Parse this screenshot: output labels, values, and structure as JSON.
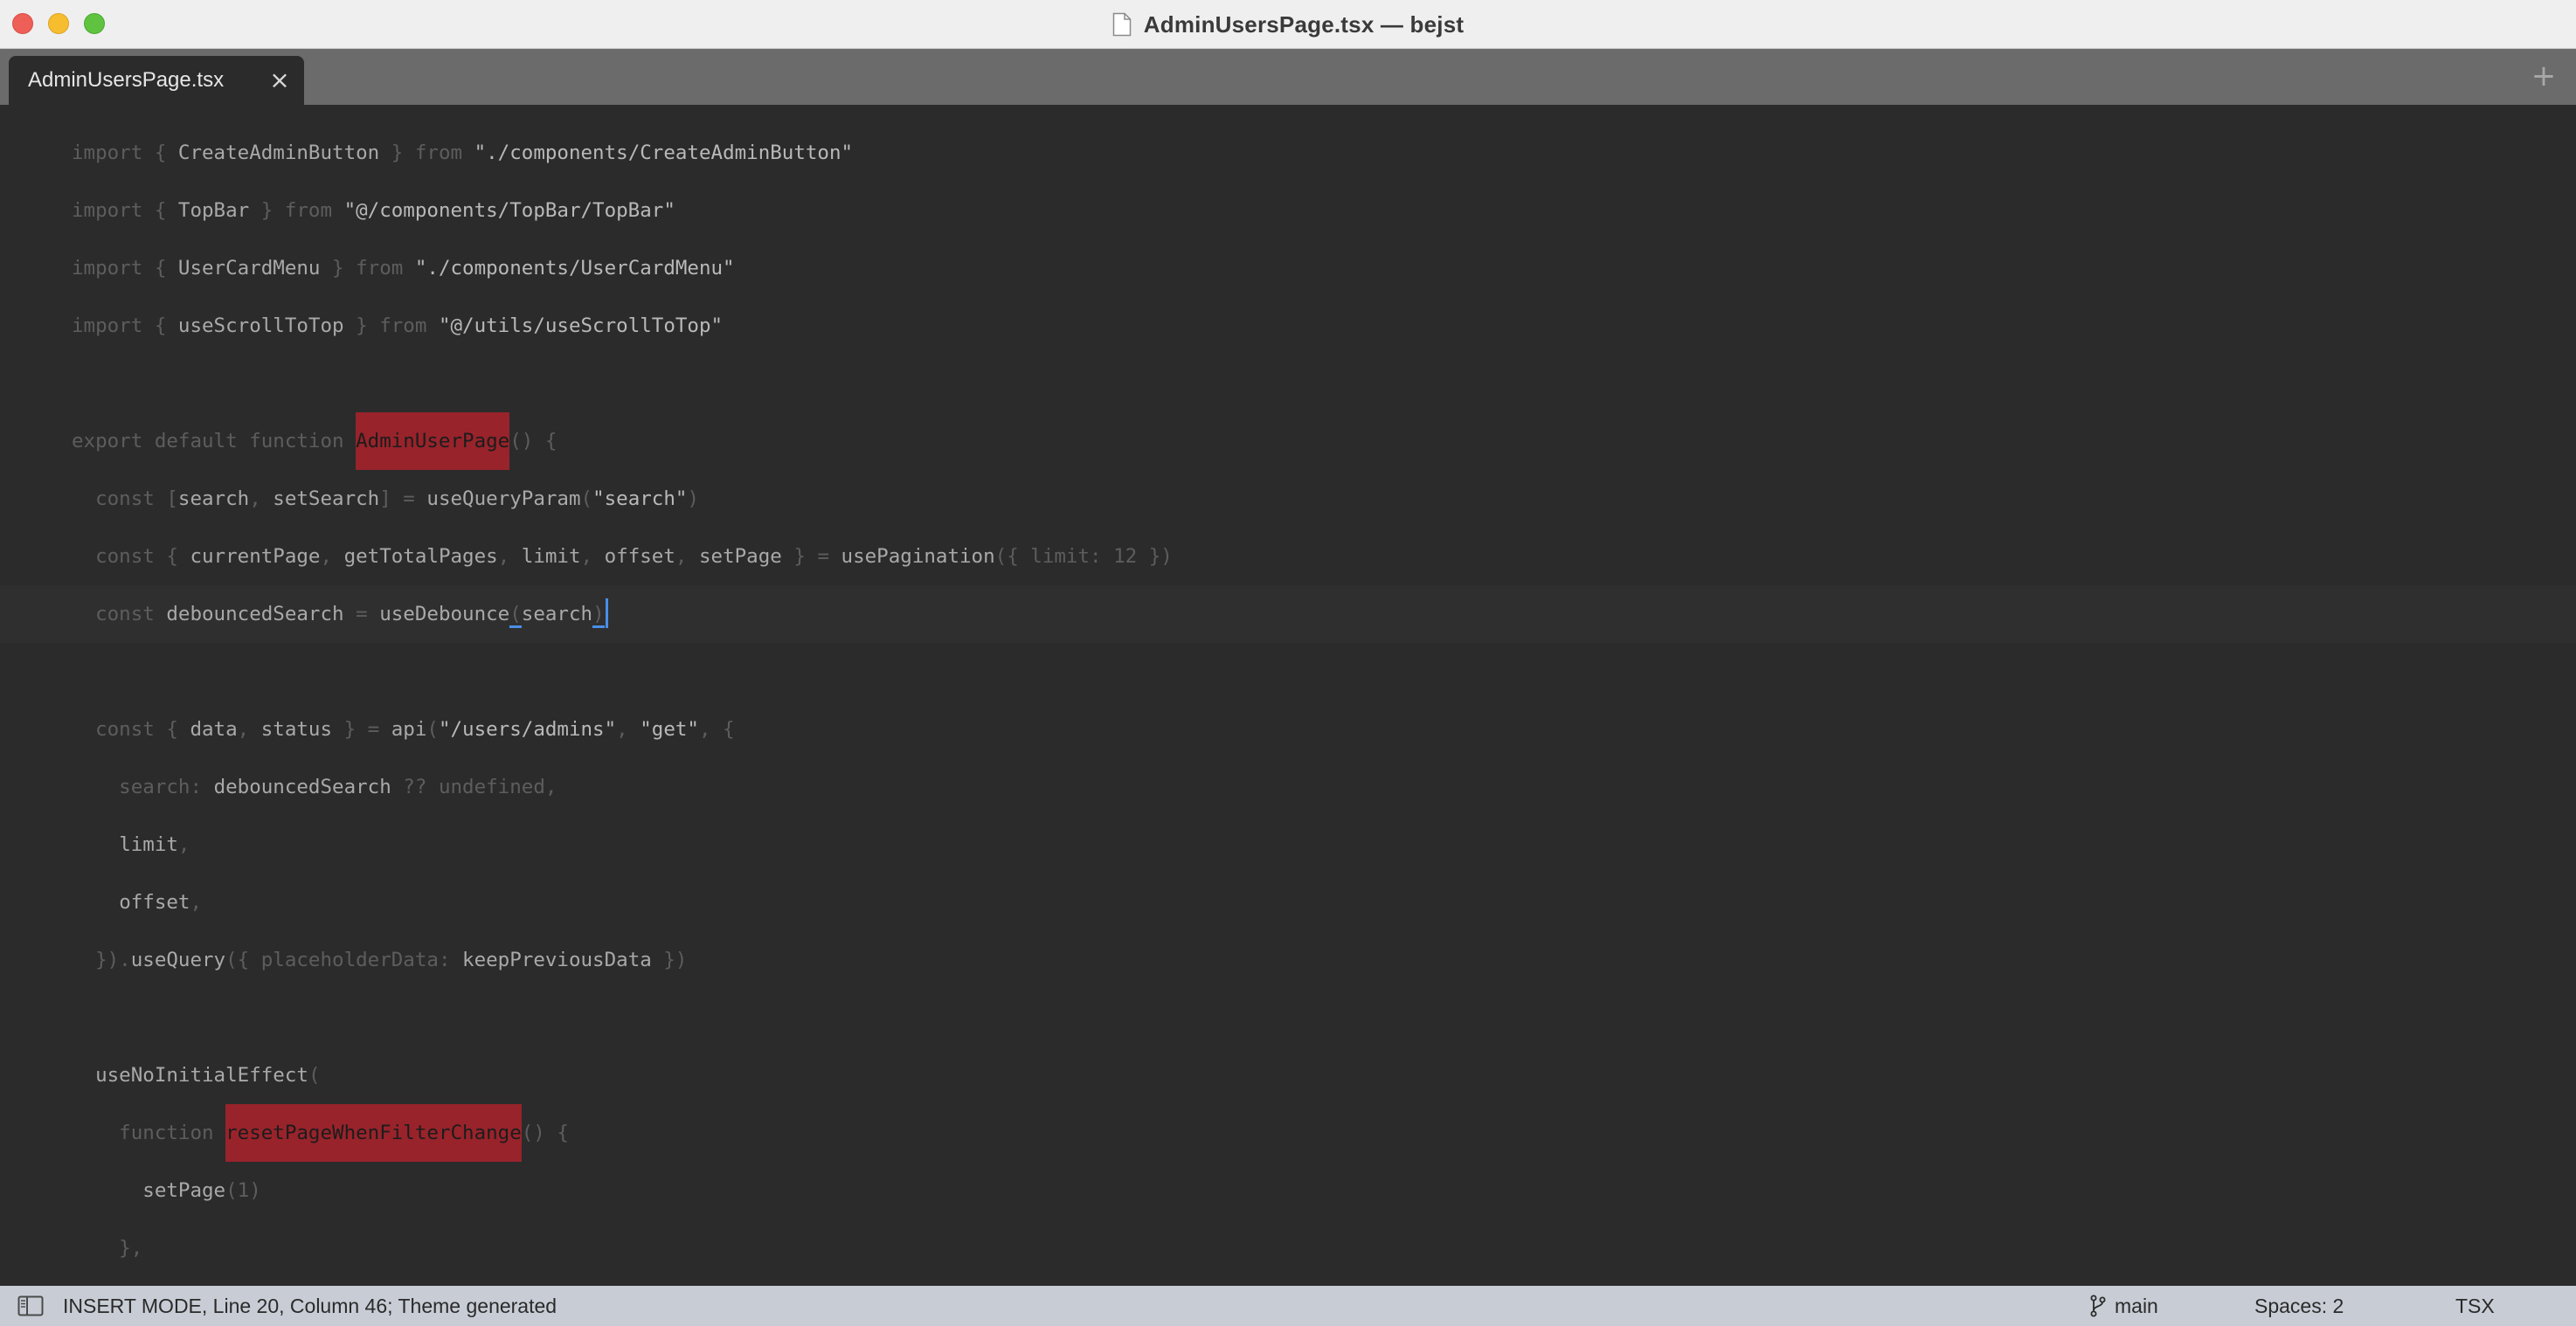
{
  "window": {
    "title": "AdminUsersPage.tsx — bejst"
  },
  "tabs": [
    {
      "label": "AdminUsersPage.tsx",
      "close_glyph": "×"
    }
  ],
  "tabbar": {
    "add_glyph": "+"
  },
  "editor": {
    "lines": [
      [
        "import { ",
        "CreateAdminButton",
        " } from ",
        "\"./components/CreateAdminButton\""
      ],
      [
        "import { ",
        "TopBar",
        " } from ",
        "\"@/components/TopBar/TopBar\""
      ],
      [
        "import { ",
        "UserCardMenu",
        " } from ",
        "\"./components/UserCardMenu\""
      ],
      [
        "import { ",
        "useScrollToTop",
        " } from ",
        "\"@/utils/useScrollToTop\""
      ],
      [],
      [
        "export default function ",
        "AdminUserPage",
        "() {"
      ],
      [
        "  const [",
        "search",
        ", ",
        "setSearch",
        "] = ",
        "useQueryParam",
        "(",
        "\"search\"",
        ")"
      ],
      [
        "  const { ",
        "currentPage",
        ", ",
        "getTotalPages",
        ", ",
        "limit",
        ", ",
        "offset",
        ", ",
        "setPage",
        " } = ",
        "usePagination",
        "({ limit: 12 })"
      ],
      [
        "  const ",
        "debouncedSearch",
        " = ",
        "useDebounce",
        "(",
        "search",
        ")"
      ],
      [],
      [
        "  const { ",
        "data",
        ", ",
        "status",
        " } = ",
        "api",
        "(",
        "\"/users/admins\"",
        ", ",
        "\"get\"",
        ", {"
      ],
      [
        "    search: ",
        "debouncedSearch",
        " ?? undefined,"
      ],
      [
        "    ",
        "limit",
        ","
      ],
      [
        "    ",
        "offset",
        ","
      ],
      [
        "  }).",
        "useQuery",
        "({ placeholderData: ",
        "keepPreviousData",
        " })"
      ],
      [],
      [
        "  ",
        "useNoInitialEffect",
        "("
      ],
      [
        "    function ",
        "resetPageWhenFilterChange",
        "() {"
      ],
      [
        "      ",
        "setPage",
        "(1)"
      ],
      [
        "    },"
      ]
    ],
    "highlighted_identifiers": [
      "AdminUserPage",
      "resetPageWhenFilterChange"
    ]
  },
  "statusbar": {
    "mode_text": "INSERT MODE, Line 20, Column 46; Theme generated",
    "branch": "main",
    "spaces": "Spaces: 2",
    "syntax": "TSX"
  },
  "colors": {
    "title_bar": "#efefef",
    "tab_bar": "#6b6b6b",
    "editor_bg": "#2b2b2b",
    "highlight": "#98232b",
    "cursor": "#4a8fe7",
    "status_bar": "#c8cdd5"
  },
  "icons": {
    "close": "close-icon",
    "document": "document-icon",
    "add_tab": "plus-icon",
    "sidebar": "sidebar-toggle-icon",
    "branch": "git-branch-icon"
  }
}
